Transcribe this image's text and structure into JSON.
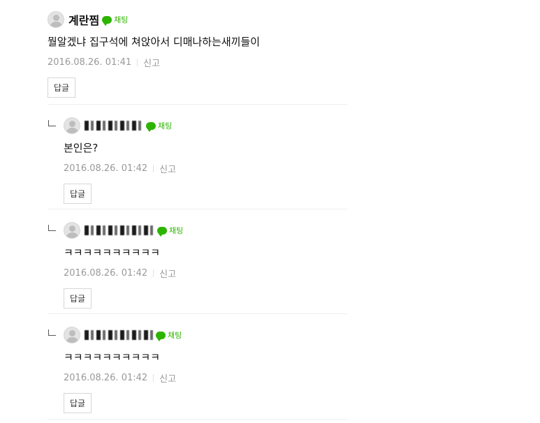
{
  "main_comment": {
    "nickname": "계란찜",
    "chat_label": "채팅",
    "text": "뭘알겠냐 집구석에 쳐앉아서 디매나하는새끼들이",
    "date": "2016.08.26. 01:41",
    "report_label": "신고",
    "reply_label": "답글"
  },
  "replies": [
    {
      "chat_label": "채팅",
      "text": "본인은?",
      "date": "2016.08.26. 01:42",
      "report_label": "신고",
      "reply_label": "답글"
    },
    {
      "chat_label": "채팅",
      "text": "ㅋㅋㅋㅋㅋㅋㅋㅋㅋㅋ",
      "date": "2016.08.26. 01:42",
      "report_label": "신고",
      "reply_label": "답글"
    },
    {
      "chat_label": "채팅",
      "text": "ㅋㅋㅋㅋㅋㅋㅋㅋㅋㅋ",
      "date": "2016.08.26. 01:42",
      "report_label": "신고",
      "reply_label": "답글"
    }
  ],
  "icons": {
    "avatar": "user-silhouette",
    "chat": "speech-bubble",
    "reply": "reply-arrow"
  },
  "colors": {
    "chat_green": "#2db400",
    "meta_gray": "#999999"
  }
}
